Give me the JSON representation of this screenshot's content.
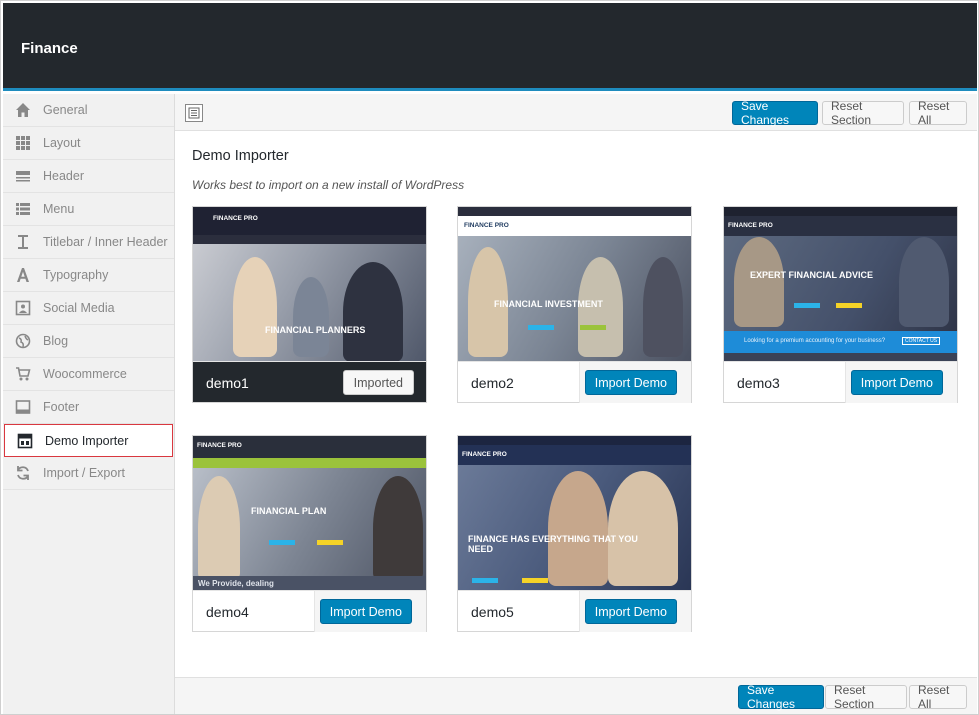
{
  "app": {
    "title": "Finance"
  },
  "sidebar": {
    "items": [
      {
        "label": "General",
        "icon": "home-icon"
      },
      {
        "label": "Layout",
        "icon": "grid-icon"
      },
      {
        "label": "Header",
        "icon": "header-icon"
      },
      {
        "label": "Menu",
        "icon": "list-icon"
      },
      {
        "label": "Titlebar / Inner Header",
        "icon": "text-cursor-icon"
      },
      {
        "label": "Typography",
        "icon": "typography-icon"
      },
      {
        "label": "Social Media",
        "icon": "share-icon"
      },
      {
        "label": "Blog",
        "icon": "globe-icon"
      },
      {
        "label": "Woocommerce",
        "icon": "cart-icon"
      },
      {
        "label": "Footer",
        "icon": "footer-icon"
      },
      {
        "label": "Demo Importer",
        "icon": "importer-icon",
        "active": true
      },
      {
        "label": "Import / Export",
        "icon": "refresh-icon"
      }
    ]
  },
  "toolbar": {
    "save_label": "Save Changes",
    "reset_section_label": "Reset Section",
    "reset_all_label": "Reset All"
  },
  "section": {
    "title": "Demo Importer",
    "description": "Works best to import on a new install of WordPress"
  },
  "demos": [
    {
      "name": "demo1",
      "status": "imported",
      "button_label": "Imported",
      "thumb": {
        "logo": "FINANCE PRO",
        "headline": "FINANCIAL PLANNERS",
        "theme": "dark"
      }
    },
    {
      "name": "demo2",
      "status": "available",
      "button_label": "Import Demo",
      "thumb": {
        "logo": "FINANCE PRO",
        "headline": "FINANCIAL INVESTMENT",
        "theme": "light"
      }
    },
    {
      "name": "demo3",
      "status": "available",
      "button_label": "Import Demo",
      "thumb": {
        "logo": "FINANCE PRO",
        "headline": "EXPERT FINANCIAL ADVICE",
        "tagline": "Looking for a premium accounting for your business?",
        "cta": "CONTACT US",
        "theme": "blue"
      }
    },
    {
      "name": "demo4",
      "status": "available",
      "button_label": "Import Demo",
      "thumb": {
        "logo": "FINANCE PRO",
        "headline": "FINANCIAL PLAN",
        "subline": "We Provide, dealing",
        "theme": "green"
      }
    },
    {
      "name": "demo5",
      "status": "available",
      "button_label": "Import Demo",
      "thumb": {
        "logo": "FINANCE PRO",
        "headline": "FINANCE HAS EVERYTHING THAT YOU NEED",
        "theme": "navy"
      }
    }
  ],
  "colors": {
    "accent": "#0085ba",
    "header_bg": "#23282d",
    "active_border": "#d9373f",
    "green_nav": "#9bc33b",
    "yellow": "#f5d327"
  }
}
